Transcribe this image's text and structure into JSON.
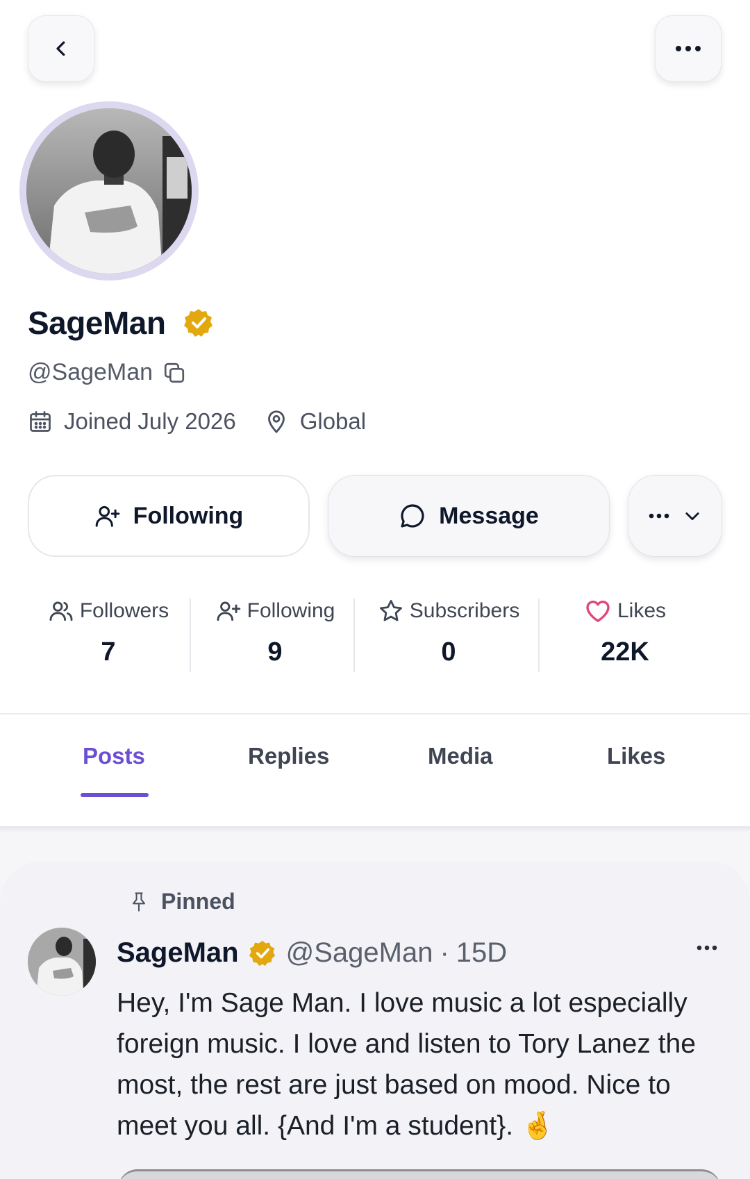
{
  "profile": {
    "display_name": "SageMan",
    "handle": "@SageMan",
    "joined": "Joined July 2026",
    "location": "Global",
    "verified": true,
    "verified_color": "#E3A80F"
  },
  "actions": {
    "following_label": "Following",
    "message_label": "Message"
  },
  "stats": [
    {
      "label": "Followers",
      "value": "7",
      "icon": "users-icon"
    },
    {
      "label": "Following",
      "value": "9",
      "icon": "user-plus-icon"
    },
    {
      "label": "Subscribers",
      "value": "0",
      "icon": "star-icon"
    },
    {
      "label": "Likes",
      "value": "22K",
      "icon": "heart-icon"
    }
  ],
  "tabs": [
    {
      "label": "Posts",
      "active": true
    },
    {
      "label": "Replies",
      "active": false
    },
    {
      "label": "Media",
      "active": false
    },
    {
      "label": "Likes",
      "active": false
    }
  ],
  "accent_color": "#6C4FD2",
  "heart_color": "#E0457B",
  "post": {
    "pinned_label": "Pinned",
    "author": "SageMan",
    "handle": "@SageMan",
    "separator": "·",
    "time": "15D",
    "text": "Hey, I'm Sage Man. I love music a lot especially foreign music. I love and listen to Tory Lanez the most, the rest are just based on mood. Nice to meet you all. {And I'm a student}. 🤞"
  }
}
